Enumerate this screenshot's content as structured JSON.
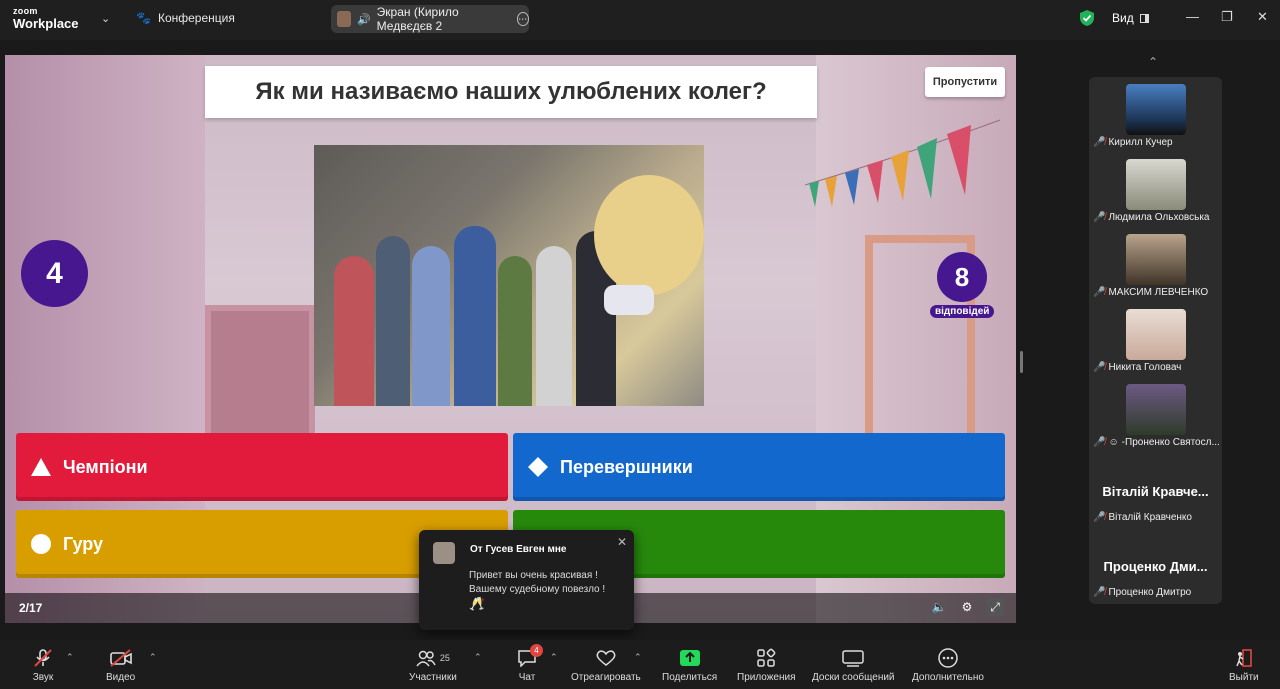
{
  "app": {
    "logo_top": "zoom",
    "logo_bottom": "Workplace",
    "meeting_name": "Конференция",
    "view_label": "Вид"
  },
  "share": {
    "label": "Экран (Кирило Медвєдєв 2"
  },
  "quiz": {
    "question": "Як ми називаємо наших улюблених колег?",
    "skip_label": "Пропустити",
    "timer": "4",
    "answers_count": "8",
    "answers_label": "відповідей",
    "progress": "2/17",
    "answers": [
      {
        "label": "Чемпіони",
        "shape": "triangle",
        "color": "#e21b3c"
      },
      {
        "label": "Перевершники",
        "shape": "diamond",
        "color": "#1368ce"
      },
      {
        "label": "Гуру",
        "shape": "circle",
        "color": "#d89e00"
      },
      {
        "label": "",
        "shape": "square",
        "color": "#26890c"
      }
    ]
  },
  "participants": [
    {
      "name": "Кирилл Кучер"
    },
    {
      "name": "Людмила Ольховська"
    },
    {
      "name": "МАКСИМ ЛЕВЧЕНКО"
    },
    {
      "name": "Никита Головач"
    },
    {
      "name": "-Проненко Святосл..."
    },
    {
      "big": "Віталій Кравче...",
      "name": "Віталій Кравченко"
    },
    {
      "big": "Проценко Дми...",
      "name": "Проценко Дмитро"
    }
  ],
  "chat_popup": {
    "from": "От Гусев Евген мне",
    "message_1": "Привет вы очень красивая !",
    "message_2": "Вашему судебному повезло !",
    "emoji": "🥂"
  },
  "toolbar": {
    "audio": "Звук",
    "video": "Видео",
    "participants": "Участники",
    "participants_count": "25",
    "chat": "Чат",
    "chat_badge": "4",
    "react": "Отреагировать",
    "share": "Поделиться",
    "apps": "Приложения",
    "whiteboards": "Доски сообщений",
    "more": "Дополнительно",
    "leave": "Выйти"
  },
  "colors": {
    "kahoot_purple": "#46178f",
    "zoom_green_share": "#23d959",
    "mic_off_red": "#e0463f"
  }
}
